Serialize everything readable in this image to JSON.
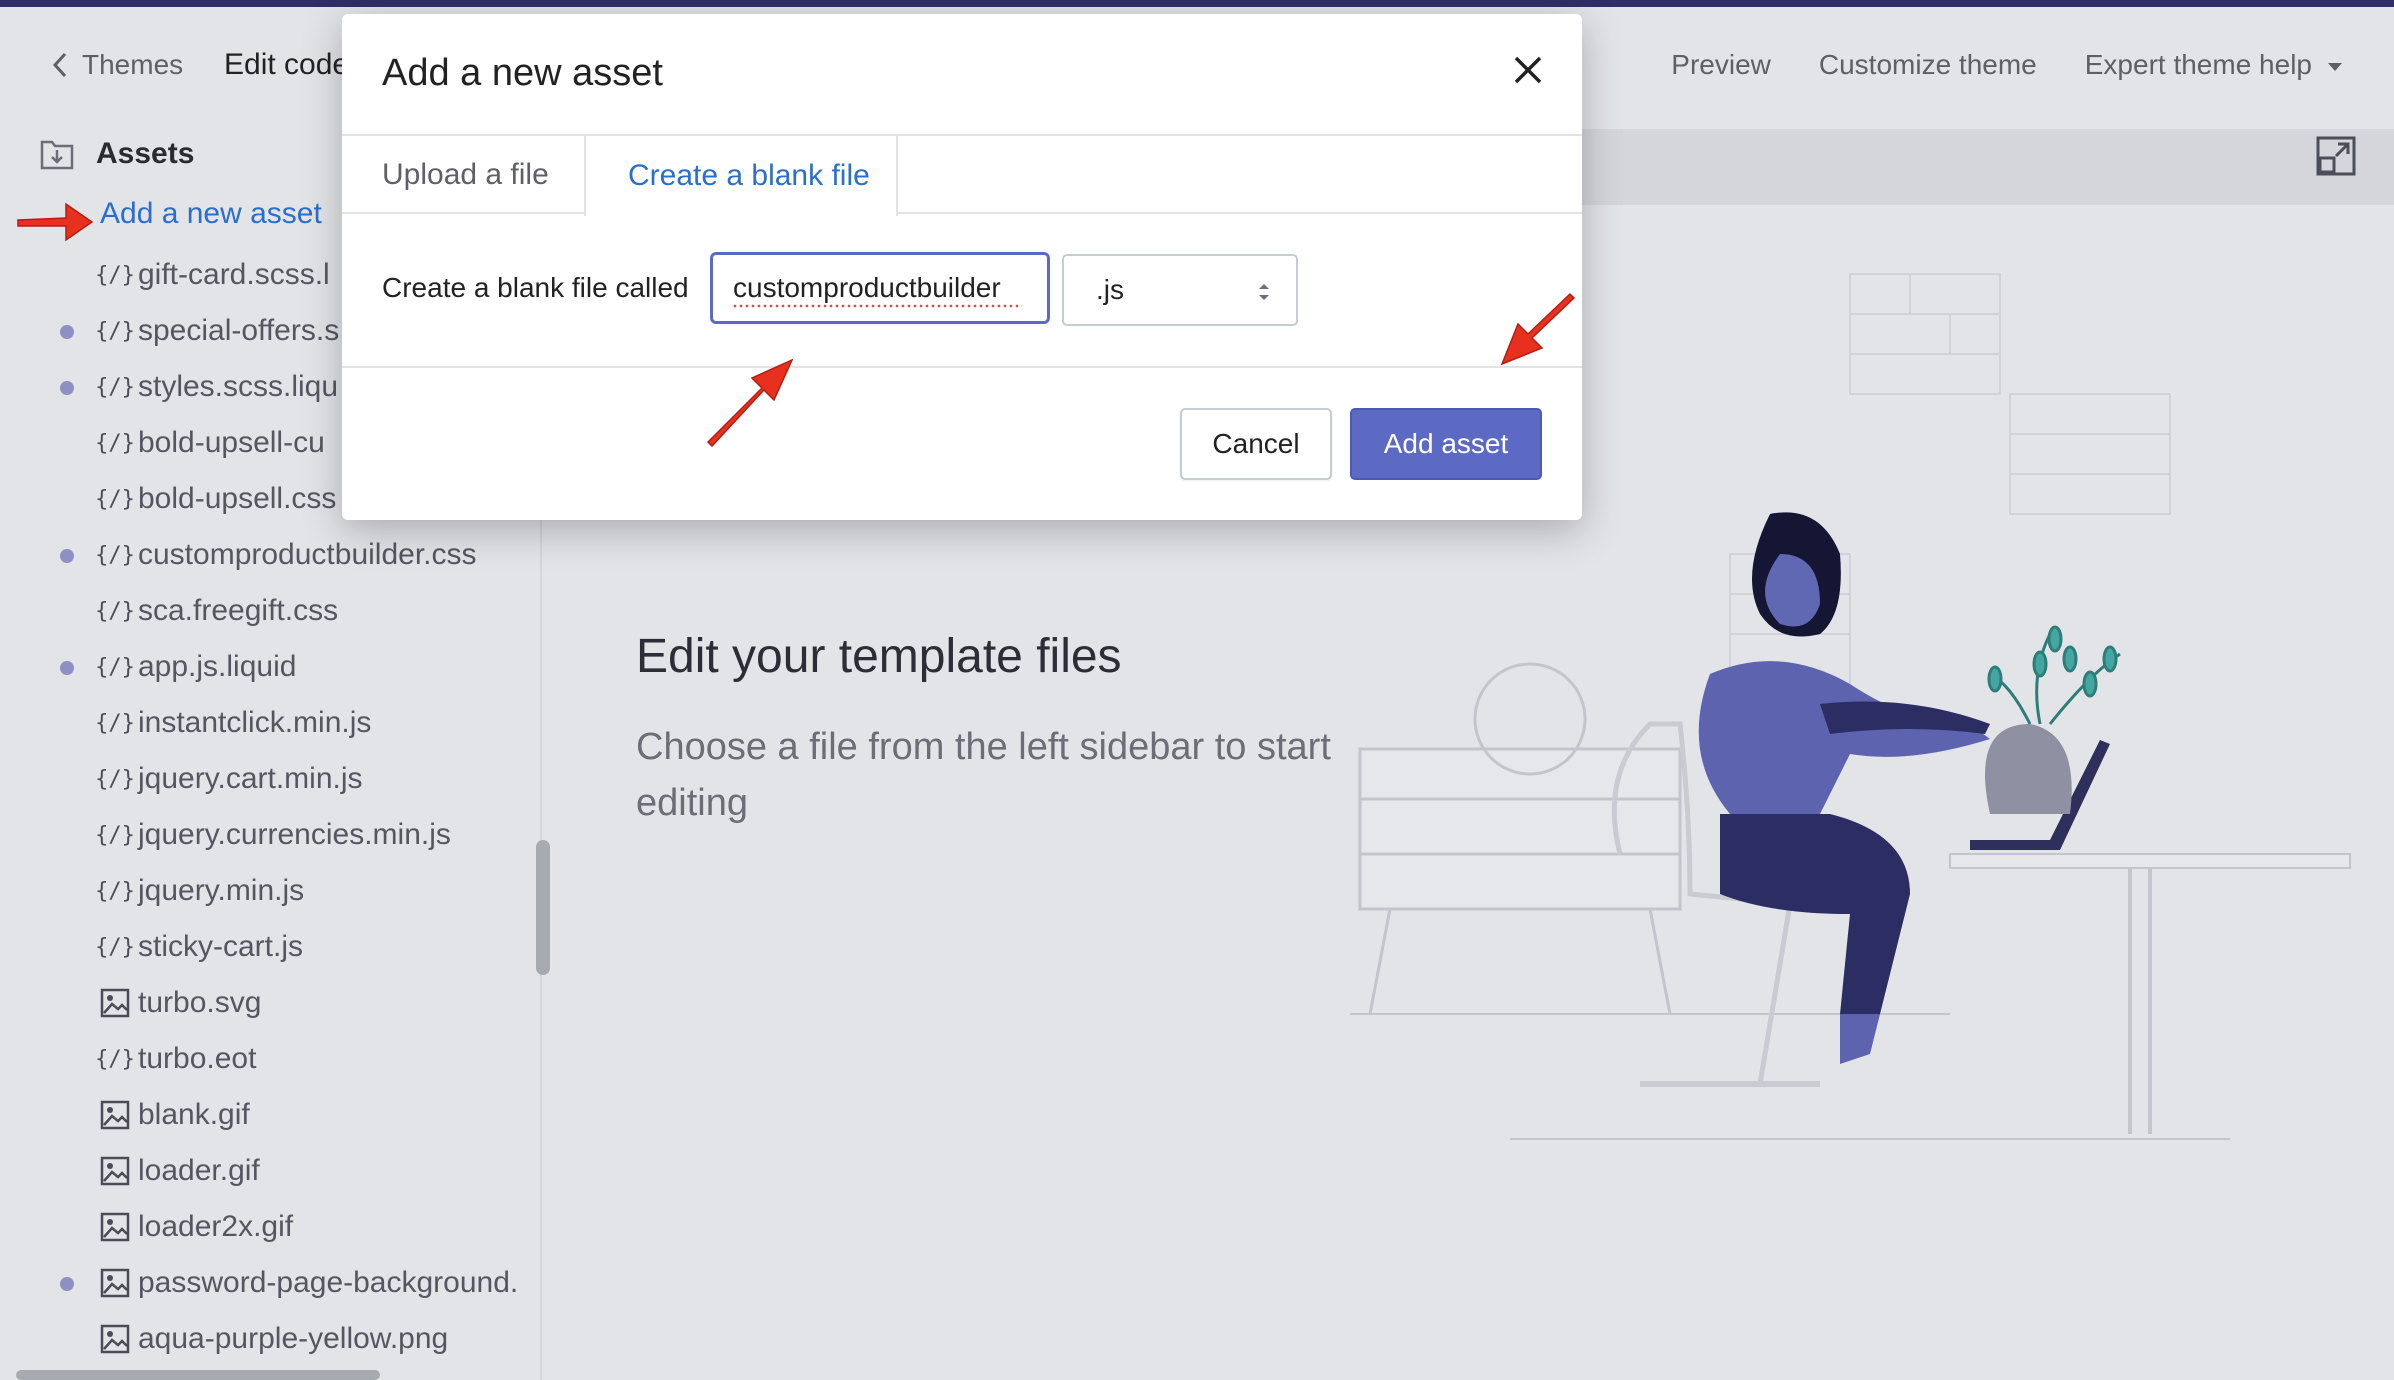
{
  "topbar": {
    "back_label": "Themes",
    "page_title": "Edit code",
    "actions": [
      "Preview",
      "Customize theme",
      "Expert theme help"
    ]
  },
  "sidebar": {
    "section_title": "Assets",
    "add_link": "Add a new asset",
    "files": [
      {
        "name": "gift-card.scss.l",
        "type": "code",
        "modified": false
      },
      {
        "name": "special-offers.s",
        "type": "code",
        "modified": true
      },
      {
        "name": "styles.scss.liqu",
        "type": "code",
        "modified": true
      },
      {
        "name": "bold-upsell-cu",
        "type": "code",
        "modified": false
      },
      {
        "name": "bold-upsell.css",
        "type": "code",
        "modified": false
      },
      {
        "name": "customproductbuilder.css",
        "type": "code",
        "modified": true
      },
      {
        "name": "sca.freegift.css",
        "type": "code",
        "modified": false
      },
      {
        "name": "app.js.liquid",
        "type": "code",
        "modified": true
      },
      {
        "name": "instantclick.min.js",
        "type": "code",
        "modified": false
      },
      {
        "name": "jquery.cart.min.js",
        "type": "code",
        "modified": false
      },
      {
        "name": "jquery.currencies.min.js",
        "type": "code",
        "modified": false
      },
      {
        "name": "jquery.min.js",
        "type": "code",
        "modified": false
      },
      {
        "name": "sticky-cart.js",
        "type": "code",
        "modified": false
      },
      {
        "name": "turbo.svg",
        "type": "image",
        "modified": false
      },
      {
        "name": "turbo.eot",
        "type": "code",
        "modified": false
      },
      {
        "name": "blank.gif",
        "type": "image",
        "modified": false
      },
      {
        "name": "loader.gif",
        "type": "image",
        "modified": false
      },
      {
        "name": "loader2x.gif",
        "type": "image",
        "modified": false
      },
      {
        "name": "password-page-background.",
        "type": "image",
        "modified": true
      },
      {
        "name": "aqua-purple-yellow.png",
        "type": "image",
        "modified": false
      }
    ],
    "code_icon_glyph": "{/}"
  },
  "main": {
    "title": "Edit your template files",
    "description": "Choose a file from the left sidebar to start editing"
  },
  "modal": {
    "title": "Add a new asset",
    "tabs": [
      "Upload a file",
      "Create a blank file"
    ],
    "active_tab": "Create a blank file",
    "field_label": "Create a blank file called",
    "filename_value": "customproductbuilder",
    "extension_value": ".js",
    "cancel_label": "Cancel",
    "submit_label": "Add asset"
  },
  "colors": {
    "accent": "#5c6ac4",
    "link": "#2c6ecb",
    "annotation_arrow": "#e8301f",
    "modified_dot": "#8d90c4"
  },
  "icons": [
    "chevron-left-icon",
    "folder-download-icon",
    "code-file-icon",
    "image-file-icon",
    "expand-icon",
    "close-icon",
    "select-arrows-icon",
    "caret-down-icon"
  ]
}
